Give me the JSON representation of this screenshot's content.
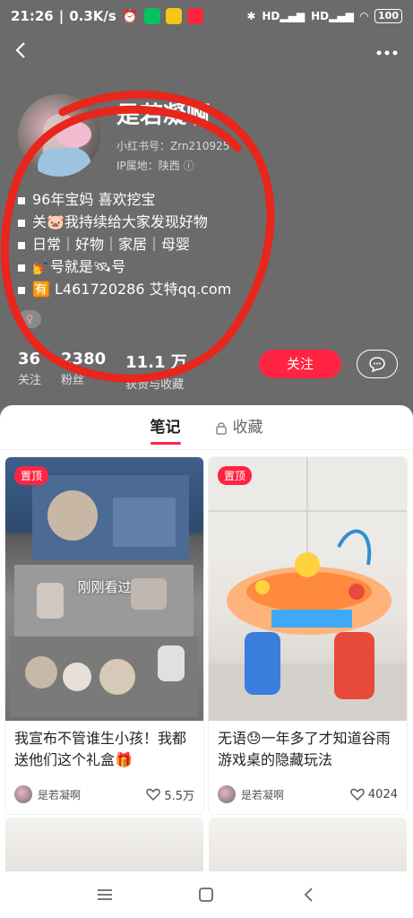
{
  "status_bar": {
    "time": "21:26",
    "network_speed": "0.3K/s",
    "signal1": "HD",
    "signal2": "HD",
    "battery": "100"
  },
  "profile": {
    "username": "是若凝啊",
    "rednote_id": "小红书号：Zrn210925",
    "ip_location": "IP属地：陕西",
    "bio_lines": [
      "96年宝妈 喜欢挖宝",
      "关🐷我持续给大家发现好物",
      "日常｜好物｜家居｜母婴",
      "💅号就是🛰号",
      "🈶 L461720286 艾特qq.com"
    ],
    "gender_symbol": "♀"
  },
  "stats": [
    {
      "value": "36",
      "label": "关注"
    },
    {
      "value": "2380",
      "label": "粉丝"
    },
    {
      "value": "11.1 万",
      "label": "获赞与收藏"
    }
  ],
  "actions": {
    "follow_label": "关注"
  },
  "tabs": [
    {
      "label": "笔记",
      "active": true
    },
    {
      "label": "收藏",
      "active": false
    }
  ],
  "notes": [
    {
      "pin": "置顶",
      "overlay": "刚刚看过",
      "title": "我宣布不管谁生小孩！我都送他们这个礼盒🎁",
      "author": "是若凝啊",
      "likes": "5.5万"
    },
    {
      "pin": "置顶",
      "title": "无语😓一年多了才知道谷雨游戏桌的隐藏玩法",
      "author": "是若凝啊",
      "likes": "4024"
    }
  ],
  "colors": {
    "header_bg": "#6b6b6b",
    "accent": "#ff2442",
    "scribble": "#e8261c"
  },
  "icons": {
    "back": "chevron-left-icon",
    "more": "more-dots-icon",
    "chat": "chat-bubble-icon",
    "lock": "lock-icon",
    "heart": "heart-icon",
    "nav_menu": "menu-icon",
    "nav_home": "home-square-icon",
    "nav_back": "back-triangle-icon"
  }
}
